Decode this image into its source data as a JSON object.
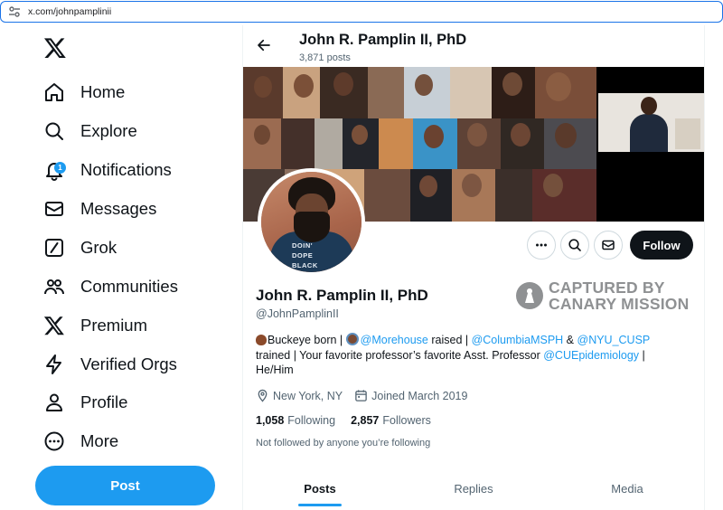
{
  "browser": {
    "url": "x.com/johnpamplinii"
  },
  "sidebar": {
    "items": [
      {
        "label": "Home",
        "icon": "home-icon"
      },
      {
        "label": "Explore",
        "icon": "search-icon"
      },
      {
        "label": "Notifications",
        "icon": "bell-icon",
        "badge": "1"
      },
      {
        "label": "Messages",
        "icon": "envelope-icon"
      },
      {
        "label": "Grok",
        "icon": "grok-icon"
      },
      {
        "label": "Communities",
        "icon": "people-icon"
      },
      {
        "label": "Premium",
        "icon": "x-logo-icon"
      },
      {
        "label": "Verified Orgs",
        "icon": "lightning-icon"
      },
      {
        "label": "Profile",
        "icon": "person-icon"
      },
      {
        "label": "More",
        "icon": "more-circle-icon"
      }
    ],
    "post_label": "Post"
  },
  "header": {
    "name": "John R. Pamplin II, PhD",
    "posts_count": "3,871 posts"
  },
  "profile": {
    "avatar_shirt_text": "DOIN' DOPE BLACK",
    "name": "John R. Pamplin II, PhD",
    "handle": "@JohnPamplinII",
    "follow_label": "Follow",
    "bio": {
      "part1": "Buckeye born | ",
      "link1": "@Morehouse",
      "part2": " raised | ",
      "link2": "@ColumbiaMSPH",
      "part3": " & ",
      "link3": "@NYU_CUSP",
      "part4": " trained | Your favorite professor’s favorite Asst. Professor ",
      "link4": "@CUEpidemiology",
      "part5": " | He/Him"
    },
    "location": "New York, NY",
    "joined": "Joined March 2019",
    "following_count": "1,058",
    "following_label": "Following",
    "followers_count": "2,857",
    "followers_label": "Followers",
    "not_followed": "Not followed by anyone you’re following"
  },
  "watermark": {
    "line1": "CAPTURED BY",
    "line2": "CANARY MISSION"
  },
  "tabs": [
    "Posts",
    "Replies",
    "Media"
  ],
  "colors": {
    "accent": "#1d9bf0",
    "text": "#0f1419",
    "muted": "#536471",
    "watermark": "#8f9193"
  }
}
